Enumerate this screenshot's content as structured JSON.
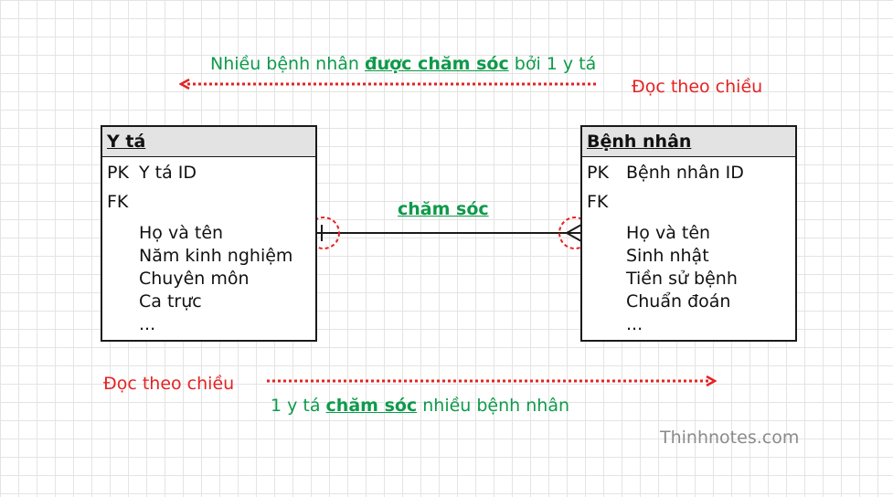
{
  "top_caption": {
    "prefix": "Nhiều bệnh nhân ",
    "bold": "được chăm sóc",
    "suffix": " bởi 1 y tá"
  },
  "top_direction_label": "Đọc theo chiều",
  "bottom_direction_label": "Đọc theo chiều",
  "bottom_caption": {
    "prefix": "1 y tá ",
    "bold": "chăm sóc",
    "suffix": " nhiều bệnh nhân"
  },
  "relationship_label": "chăm sóc",
  "entity_left": {
    "title": "Y tá",
    "pk_label": "PK",
    "pk_field": "Y tá ID",
    "fk_label": "FK",
    "attributes": [
      "Họ và tên",
      "Năm kinh nghiệm",
      "Chuyên môn",
      "Ca trực",
      "..."
    ]
  },
  "entity_right": {
    "title": "Bệnh nhân",
    "pk_label": "PK",
    "pk_field": "Bệnh nhân ID",
    "fk_label": "FK",
    "attributes": [
      "Họ và tên",
      "Sinh nhật",
      "Tiền sử bệnh",
      "Chuẩn đoán",
      "..."
    ]
  },
  "watermark": "Thinhnotes.com",
  "colors": {
    "caption_green": "#0e9a4a",
    "arrow_red": "#e52222",
    "line": "#1a1a1a"
  }
}
